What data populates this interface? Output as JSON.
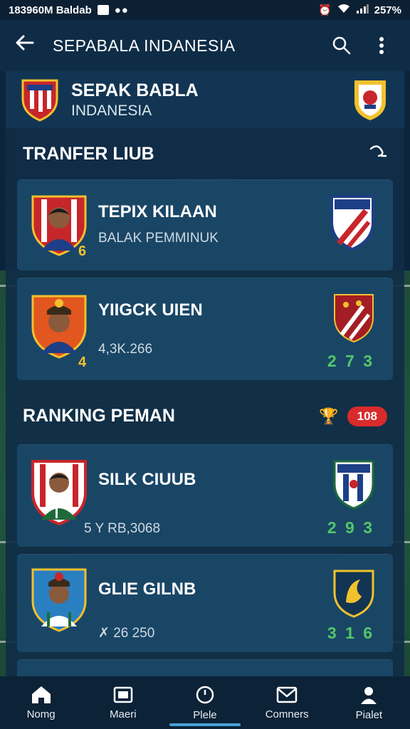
{
  "status_bar": {
    "left_text": "183960M Baldab",
    "right_text": "257%"
  },
  "app_bar": {
    "back_icon": "arrow-left-icon",
    "title": "SEPABALA INDANESIA",
    "search_icon": "search-icon",
    "menu_icon": "more-vertical-icon"
  },
  "banner": {
    "line1": "SEPAK BABLA",
    "line2": "INDANESIA"
  },
  "transfer_section": {
    "title": "TRANFER LIUB",
    "action_icon": "share-icon",
    "cards": [
      {
        "name": "TEPIX KILAAN",
        "sub": "BALAK PEMMINUK",
        "num_left": "6",
        "score": ""
      },
      {
        "name": "YIIGCK UIEN",
        "sub": "4,3K.266",
        "num_left": "4",
        "score": "2 7 3"
      }
    ]
  },
  "ranking_section": {
    "title": "RANKING PEMAN",
    "badge": "108",
    "trophy_icon": "trophy-icon",
    "cards": [
      {
        "name": "SILK CIUUB",
        "sub": "5  Y RB,3068",
        "score": "2 9 3"
      },
      {
        "name": "GLIE GILNB",
        "sub": "✗ 26 250",
        "score": "3 1 6"
      }
    ]
  },
  "bottom_nav": [
    {
      "label": "Nomg",
      "icon": "home-icon"
    },
    {
      "label": "Maeri",
      "icon": "news-icon"
    },
    {
      "label": "Plele",
      "icon": "clock-icon"
    },
    {
      "label": "Comners",
      "icon": "mail-icon"
    },
    {
      "label": "Pialet",
      "icon": "profile-icon"
    }
  ],
  "colors": {
    "accent_green": "#55c66a",
    "accent_gold": "#f2c12e",
    "badge_red": "#d92b2b",
    "card_bg": "#1a4666"
  }
}
